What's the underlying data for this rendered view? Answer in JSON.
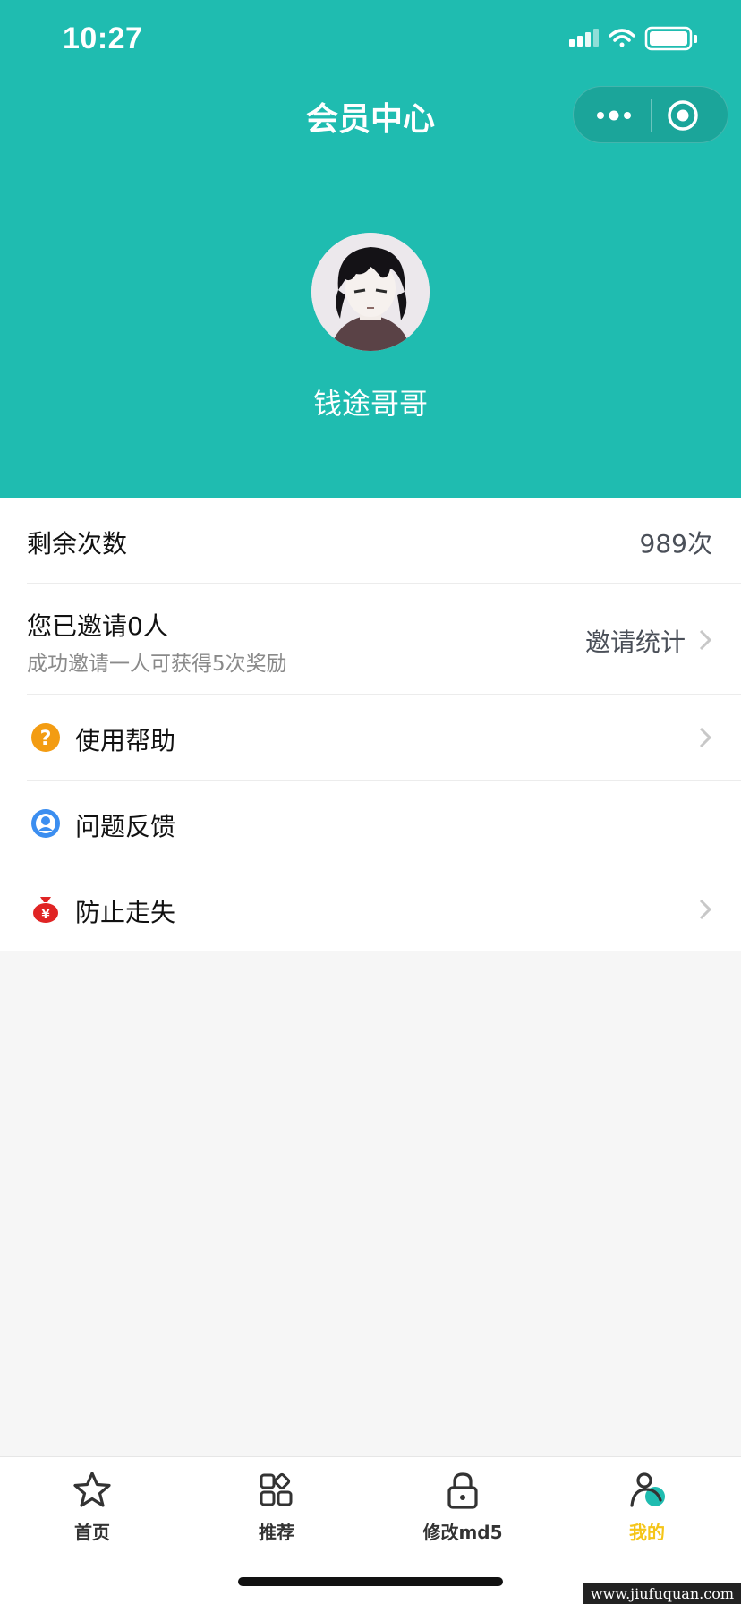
{
  "status_bar": {
    "time": "10:27",
    "icons": [
      "signal-icon",
      "wifi-icon",
      "battery-icon"
    ]
  },
  "header": {
    "title": "会员中心",
    "background_color": "#1fbcb0",
    "capsule": {
      "more_icon": "more-dots-icon",
      "close_icon": "target-circle-icon"
    }
  },
  "profile": {
    "avatar": "anime-avatar",
    "username": "钱途哥哥"
  },
  "rows": {
    "remaining": {
      "label": "剩余次数",
      "value": "989次"
    },
    "invite": {
      "label": "您已邀请0人",
      "sublabel": "成功邀请一人可获得5次奖励",
      "action": "邀请统计"
    },
    "help": {
      "label": "使用帮助",
      "icon": "question-circle-icon",
      "icon_color": "#f39c12"
    },
    "feedback": {
      "label": "问题反馈",
      "icon": "user-circle-icon",
      "icon_color": "#3b8ef0"
    },
    "prevent_lost": {
      "label": "防止走失",
      "icon": "money-bag-icon",
      "icon_color": "#e02424"
    }
  },
  "tabbar": {
    "tabs": [
      {
        "label": "首页",
        "icon": "star-icon"
      },
      {
        "label": "推荐",
        "icon": "grid-icon"
      },
      {
        "label": "修改md5",
        "icon": "lock-icon"
      },
      {
        "label": "我的",
        "icon": "user-icon",
        "active": true
      }
    ],
    "active_color": "#f5c518"
  },
  "watermark": "www.jiufuquan.com"
}
